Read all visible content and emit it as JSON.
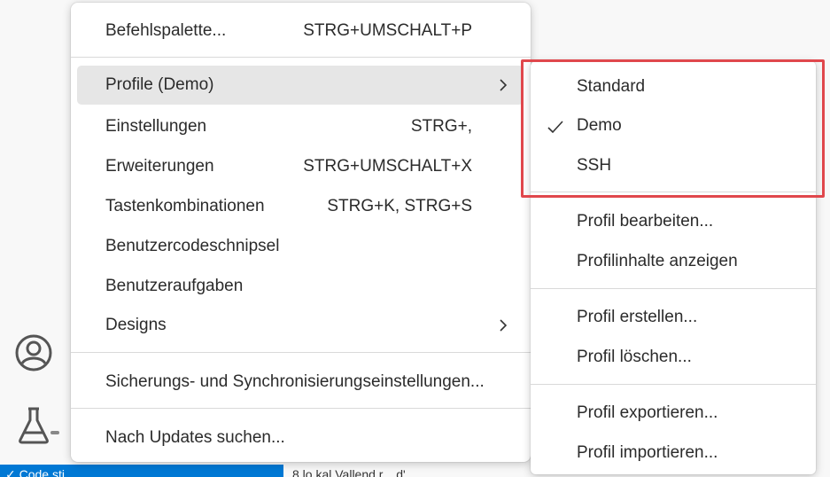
{
  "status_bar": {
    "left_text": "✓ Code                   sti",
    "right_text": "8 lo kal Vallend r... d'"
  },
  "menu": {
    "items": [
      {
        "label": "Befehlspalette...",
        "shortcut": "STRG+UMSCHALT+P"
      },
      {
        "label": "Profile (Demo)",
        "shortcut": ""
      },
      {
        "label": "Einstellungen",
        "shortcut": "STRG+,"
      },
      {
        "label": "Erweiterungen",
        "shortcut": "STRG+UMSCHALT+X"
      },
      {
        "label": "Tastenkombinationen",
        "shortcut": "STRG+K, STRG+S"
      },
      {
        "label": "Benutzercodeschnipsel",
        "shortcut": ""
      },
      {
        "label": "Benutzeraufgaben",
        "shortcut": ""
      },
      {
        "label": "Designs",
        "shortcut": ""
      },
      {
        "label": "Sicherungs- und Synchronisierungseinstellungen...",
        "shortcut": ""
      },
      {
        "label": "Nach Updates suchen...",
        "shortcut": ""
      }
    ]
  },
  "submenu": {
    "profiles": [
      {
        "label": "Standard",
        "checked": false
      },
      {
        "label": "Demo",
        "checked": true
      },
      {
        "label": "SSH",
        "checked": false
      }
    ],
    "actions": [
      {
        "label": "Profil bearbeiten..."
      },
      {
        "label": "Profilinhalte anzeigen"
      },
      {
        "label": "Profil erstellen..."
      },
      {
        "label": "Profil löschen..."
      },
      {
        "label": "Profil exportieren..."
      },
      {
        "label": "Profil importieren..."
      }
    ]
  },
  "colors": {
    "highlight_border": "#e0474c",
    "status_bar_accent": "#0078d4",
    "active_item_bg": "#e6e6e6"
  }
}
